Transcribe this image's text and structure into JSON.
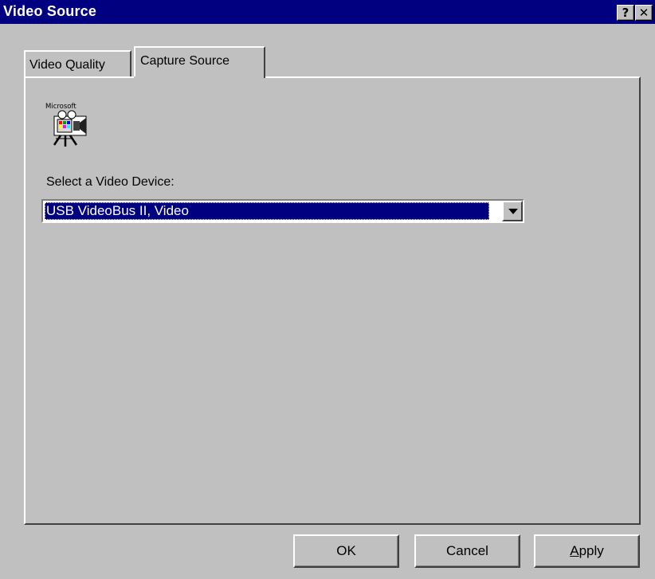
{
  "window": {
    "title": "Video Source",
    "help_button": "?",
    "close_button": "✕"
  },
  "tabs": [
    {
      "label": "Video Quality",
      "active": false
    },
    {
      "label": "Capture Source",
      "active": true
    }
  ],
  "logo": {
    "text": "Microsoft",
    "icon": "video-camera-icon"
  },
  "device": {
    "label": "Select a Video Device:",
    "selected": "USB VideoBus II, Video"
  },
  "buttons": {
    "ok": "OK",
    "cancel": "Cancel",
    "apply_accel": "A",
    "apply_rest": "pply"
  },
  "colors": {
    "titlebar": "#000080",
    "face": "#c0c0c0",
    "selection": "#000080"
  }
}
